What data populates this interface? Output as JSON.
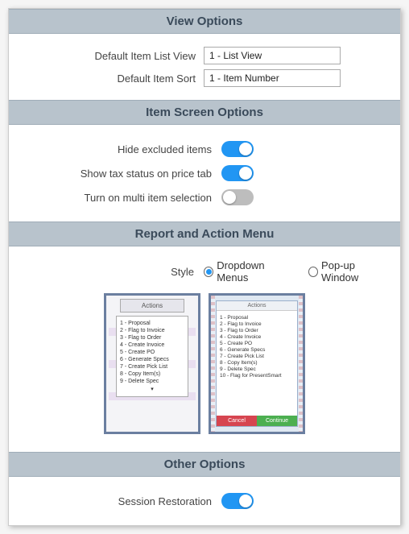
{
  "sections": {
    "view_options": {
      "title": "View Options",
      "default_list_view": {
        "label": "Default Item List View",
        "value": "1 - List View"
      },
      "default_sort": {
        "label": "Default Item Sort",
        "value": "1 - Item Number"
      }
    },
    "item_screen": {
      "title": "Item Screen Options",
      "hide_excluded": {
        "label": "Hide excluded items",
        "on": true
      },
      "show_tax": {
        "label": "Show tax status on price tab",
        "on": true
      },
      "multi_select": {
        "label": "Turn on multi item selection",
        "on": false
      }
    },
    "report_action": {
      "title": "Report and Action Menu",
      "style_label": "Style",
      "options": {
        "dropdown": "Dropdown Menus",
        "popup": "Pop-up Window"
      },
      "selected": "dropdown",
      "preview_a": {
        "head": "Actions",
        "items": [
          "1 - Proposal",
          "2 - Flag to Invoice",
          "3 - Flag to Order",
          "4 - Create Invoice",
          "5 - Create PO",
          "6 - Generate Specs",
          "7 - Create Pick List",
          "8 - Copy Item(s)",
          "9 - Delete Spec"
        ]
      },
      "preview_b": {
        "head": "Actions",
        "items": [
          "1 - Proposal",
          "2 - Flag to Invoice",
          "3 - Flag to Order",
          "4 - Create Invoice",
          "5 - Create PO",
          "6 - Generate Specs",
          "7 - Create Pick List",
          "8 - Copy Item(s)",
          "9 - Delete Spec",
          "10 - Flag for PresentSmart"
        ],
        "cancel": "Cancel",
        "continue": "Continue"
      }
    },
    "other": {
      "title": "Other Options",
      "session_restore": {
        "label": "Session Restoration",
        "on": true
      }
    }
  }
}
